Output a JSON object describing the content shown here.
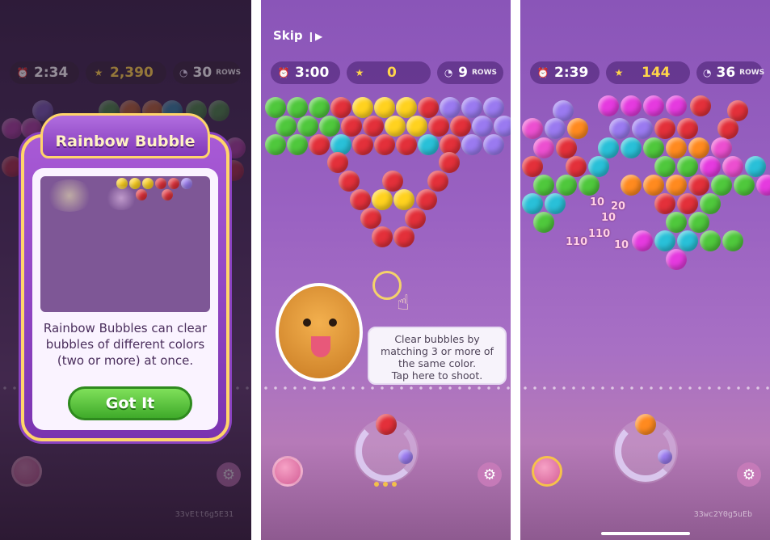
{
  "colors": {
    "red": "#e3303a",
    "green": "#4fc83c",
    "yellow": "#ffd21f",
    "purple": "#9a7af0",
    "cyan": "#29c0d8",
    "pink": "#ec4fd0",
    "orange": "#ff8a1f",
    "magenta": "#e53adf"
  },
  "screen1": {
    "timer": "2:34",
    "score": "2,390",
    "rows": "30",
    "rows_unit": "ROWS",
    "modal_title": "Rainbow Bubble",
    "modal_text": "Rainbow Bubbles can clear bubbles of different colors (two or more) at once.",
    "button_label": "Got It",
    "code": "33vEtt6g5E31"
  },
  "screen2": {
    "skip_label": "Skip",
    "timer": "3:00",
    "score": "0",
    "rows": "9",
    "rows_unit": "ROWS",
    "tip_text_line1": "Clear bubbles by",
    "tip_text_line2": "matching 3 or more of",
    "tip_text_line3": "the same color.",
    "tip_text_line4": "Tap here to shoot."
  },
  "screen3": {
    "timer": "2:39",
    "score": "144",
    "rows": "36",
    "rows_unit": "ROWS",
    "popups": [
      "10",
      "20",
      "10",
      "110",
      "110",
      "10"
    ],
    "code": "33wc2Y0g5uEb"
  },
  "icons": {
    "clock": "clock-icon",
    "star": "star-icon",
    "rows": "rows-icon",
    "gear": "gear-icon",
    "hand": "hand-pointer-icon",
    "skip": "skip-icon"
  }
}
